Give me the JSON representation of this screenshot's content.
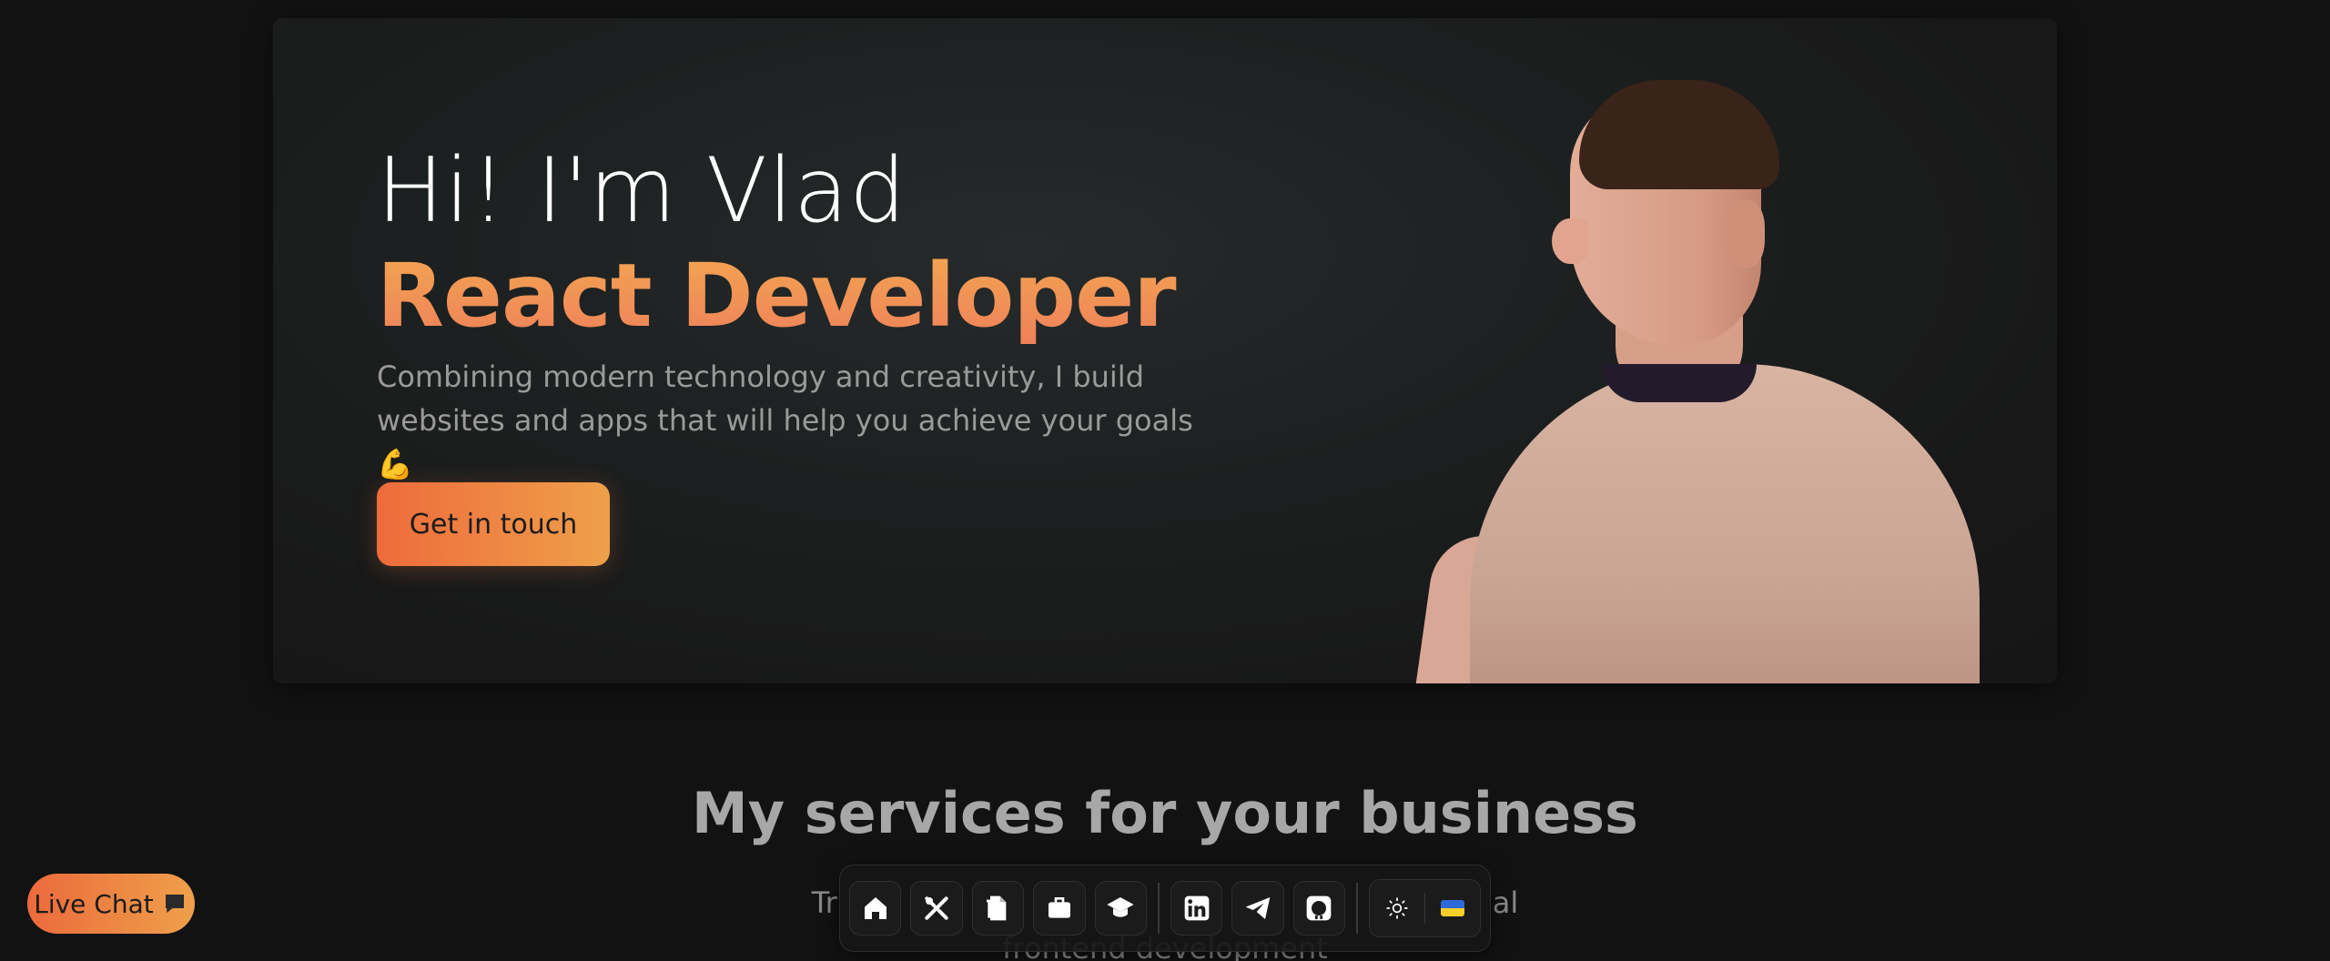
{
  "hero": {
    "greeting": "Hi! I'm Vlad",
    "role": "React Developer",
    "tagline": "Combining modern technology and creativity, I build websites and apps that will help you achieve your goals 💪",
    "cta_label": "Get in touch"
  },
  "services": {
    "title": "My services for your business",
    "subtitle_fragment_left": "Tr",
    "subtitle_fragment_right": "al",
    "subtitle_line2": "frontend development"
  },
  "dock": {
    "items": [
      {
        "icon": "home-icon"
      },
      {
        "icon": "tools-icon"
      },
      {
        "icon": "document-icon"
      },
      {
        "icon": "briefcase-icon"
      },
      {
        "icon": "graduation-cap-icon"
      },
      {
        "icon": "linkedin-icon"
      },
      {
        "icon": "telegram-icon"
      },
      {
        "icon": "github-icon"
      }
    ],
    "settings": [
      {
        "icon": "sun-icon"
      },
      {
        "icon": "ukraine-flag-icon"
      }
    ]
  },
  "live_chat": {
    "label": "Live Chat",
    "icon": "chat-bubble-icon"
  },
  "colors": {
    "accent_start": "#ee6b3c",
    "accent_end": "#eea04a",
    "background": "#121212"
  }
}
